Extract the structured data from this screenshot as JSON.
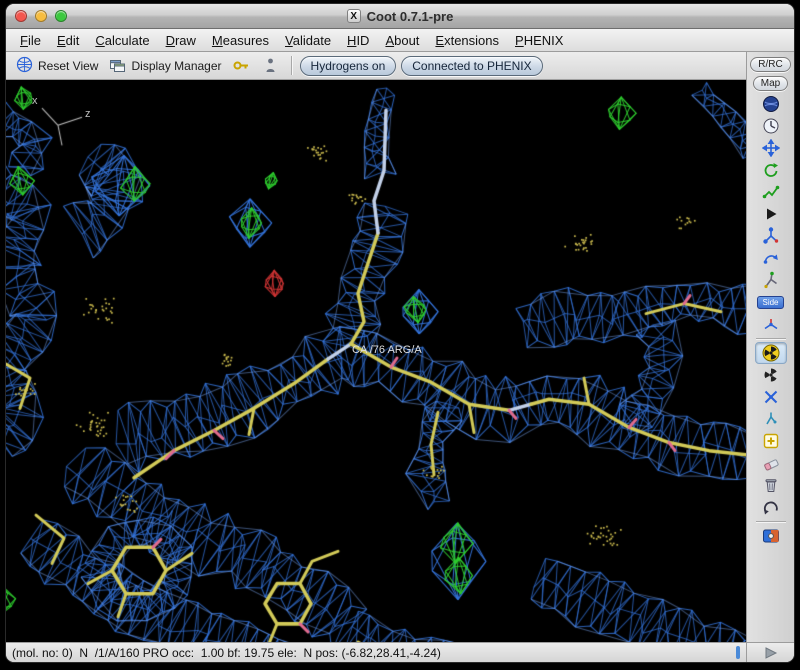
{
  "window": {
    "title": "Coot 0.7.1-pre"
  },
  "menubar": {
    "items": [
      "File",
      "Edit",
      "Calculate",
      "Draw",
      "Measures",
      "Validate",
      "HID",
      "About",
      "Extensions",
      "PHENIX"
    ]
  },
  "toolbar": {
    "reset_view": "Reset View",
    "display_manager": "Display Manager",
    "hydrogens": "Hydrogens on",
    "phenix": "Connected to PHENIX"
  },
  "right_panel": {
    "rrc_button": "R/RC",
    "map_button": "Map",
    "side_tag": "Side",
    "icons": [
      "navigation-sphere-icon",
      "recentring-view-icon",
      "rotate-translate-zone-icon",
      "rigid-body-fit-icon",
      "torsion-general-icon",
      "run-refmac-icon",
      "edit-chi-angles-icon",
      "flip-peptide-icon",
      "auto-fit-rotamer-icon",
      "side-chain-180-icon",
      "jed-flip-icon",
      "real-space-refine-icon",
      "regularize-zone-icon",
      "pepflip-icon",
      "add-alt-conf-icon",
      "add-terminal-residue-icon",
      "mutate-icon",
      "delete-item-icon",
      "undo-icon",
      "ligand-builder-icon",
      "statusbar-run-icon"
    ]
  },
  "viewport": {
    "atom_label": "CA /76 ARG/A",
    "axis_x": "x",
    "axis_z": "z"
  },
  "statusbar": {
    "text": "(mol. no: 0)  N  /1/A/160 PRO occ:  1.00 bf: 19.75 ele:  N pos: (-6.82,28.41,-4.24)"
  },
  "colors": {
    "background": "#000000",
    "mesh_blue": "#3575dd",
    "mesh_highlight": "#7aa6f2",
    "model_yellow": "#d2ca58",
    "model_lightblue": "#c2d0e8",
    "model_pink": "#e06b8e",
    "diff_positive": "#2ecc2e",
    "diff_negative": "#d23535",
    "dots_yellow": "#c9b94d"
  }
}
